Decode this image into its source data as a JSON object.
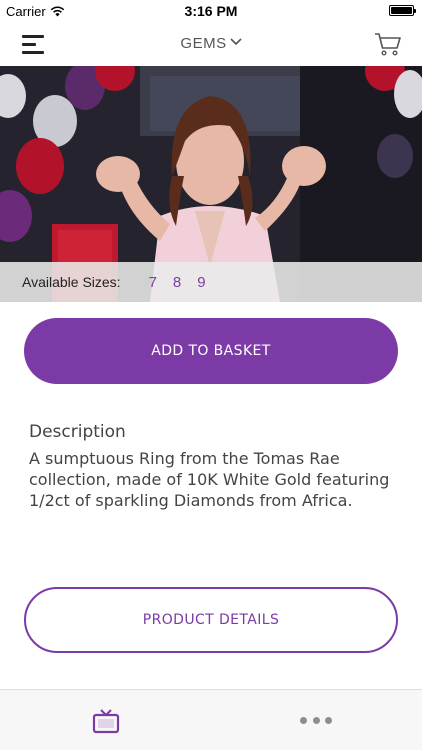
{
  "status_bar": {
    "carrier": "Carrier",
    "time": "3:16 PM"
  },
  "nav": {
    "title": "GEMS"
  },
  "product": {
    "sizes_label": "Available Sizes:",
    "sizes": [
      "7",
      "8",
      "9"
    ],
    "add_to_basket_label": "ADD TO BASKET",
    "description_heading": "Description",
    "description_text": "A sumptuous Ring from the Tomas Rae collection, made of 10K White Gold featuring 1/2ct of sparkling Diamonds from Africa.",
    "product_details_label": "PRODUCT DETAILS"
  },
  "colors": {
    "accent": "#7c3aa6",
    "size_link": "#7a3fa0"
  },
  "icons": {
    "menu": "hamburger-menu-icon",
    "cart": "shopping-cart-icon",
    "tv": "tv-icon",
    "more": "more-dots-icon"
  }
}
